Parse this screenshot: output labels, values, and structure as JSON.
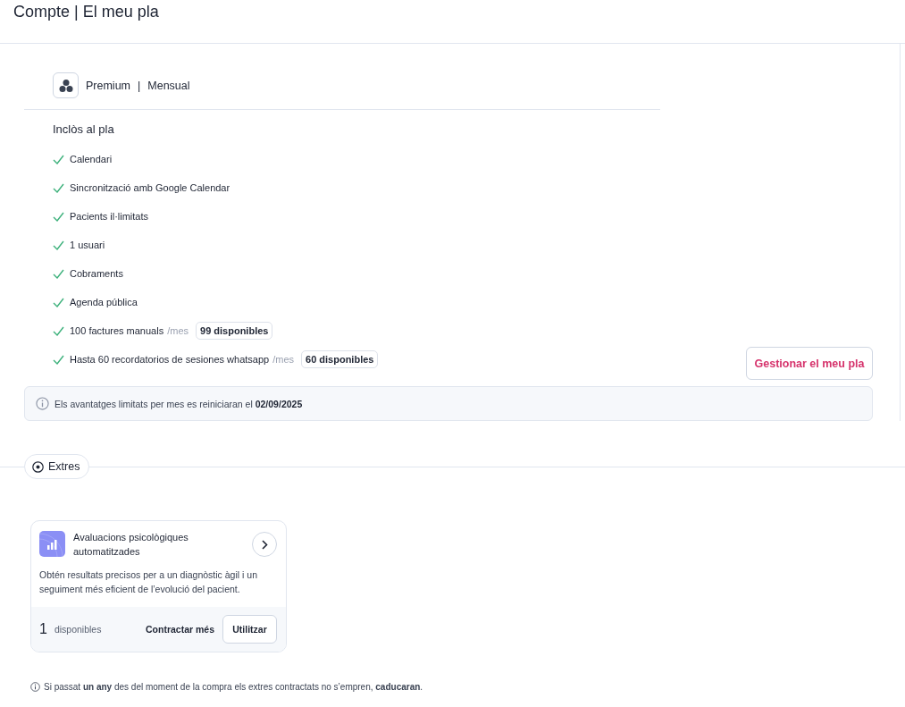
{
  "page_title": "Compte | El meu pla",
  "plan": {
    "name": "Premium",
    "separator": "|",
    "period": "Mensual"
  },
  "included": {
    "heading": "Inclòs al pla",
    "features": [
      {
        "text": "Calendari"
      },
      {
        "text": "Sincronització amb Google Calendar"
      },
      {
        "text": "Pacients il·limitats"
      },
      {
        "text": "1 usuari"
      },
      {
        "text": "Cobraments"
      },
      {
        "text": "Agenda pública"
      },
      {
        "text": "100 factures manuals",
        "unit": "/mes",
        "badge": "99 disponibles"
      },
      {
        "text": "Hasta 60 recordatorios de sesiones whatsapp",
        "unit": "/mes",
        "badge": "60 disponibles"
      }
    ]
  },
  "manage_button": "Gestionar el meu pla",
  "reset_notice": "Els avantatges limitats per mes es reiniciaran el **02/09/2025**",
  "extras_label": "Extres",
  "extras": [
    {
      "title": "Avaluacions psicològiques automatitzades",
      "description": "Obtén resultats precisos per a un diagnòstic àgil i un seguiment més eficient de l’evolució del pacient.",
      "count": "1",
      "count_label": "disponibles",
      "secondary_action": "Contractar més",
      "primary_action": "Utilitzar"
    }
  ],
  "footnote": "Si passat **un any** des del moment de la compra els extres contractats no s’empren, **caducaran**."
}
